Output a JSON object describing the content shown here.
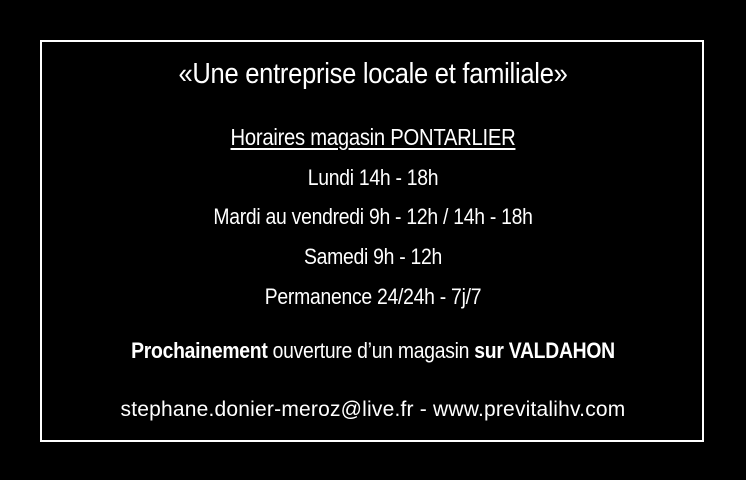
{
  "slogan": "«Une entreprise locale et familiale»",
  "hours": {
    "title": "Horaires magasin PONTARLIER",
    "lines": [
      "Lundi 14h - 18h",
      "Mardi au vendredi 9h - 12h / 14h - 18h",
      "Samedi 9h - 12h",
      "Permanence 24/24h - 7j/7"
    ]
  },
  "announcement": {
    "prefix_bold": "Prochainement",
    "middle": " ouverture d’un magasin ",
    "suffix_bold": "sur VALDAHON"
  },
  "contact": {
    "email": "stephane.donier-meroz@live.fr",
    "separator": " - ",
    "website": "www.previtalihv.com"
  },
  "colors": {
    "background": "#000000",
    "text": "#ffffff",
    "border": "#ffffff"
  }
}
